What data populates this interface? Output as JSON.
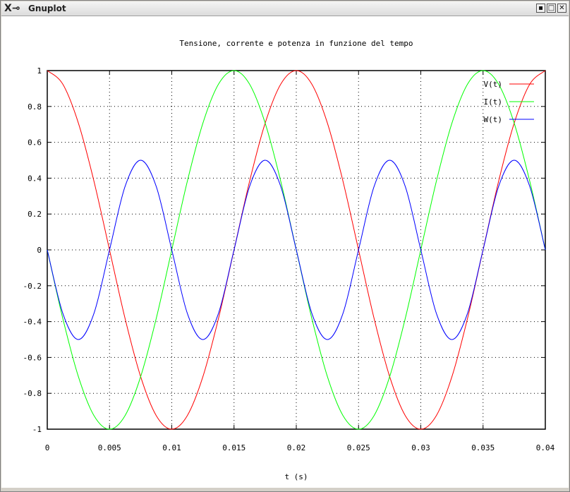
{
  "window": {
    "title": "Gnuplot",
    "icon": "x-window-icon",
    "buttons": [
      "minimize-icon",
      "maximize-icon",
      "close-icon"
    ]
  },
  "chart_data": {
    "type": "line",
    "title": "Tensione, corrente e potenza in funzione del tempo",
    "xlabel": "t (s)",
    "ylabel": "",
    "xlim": [
      0,
      0.04
    ],
    "ylim": [
      -1,
      1
    ],
    "grid": true,
    "legend_position": "top-right",
    "x_ticks": [
      "0",
      "0.005",
      "0.01",
      "0.015",
      "0.02",
      "0.025",
      "0.03",
      "0.035",
      "0.04"
    ],
    "y_ticks": [
      "1",
      "0.8",
      "0.6",
      "0.4",
      "0.2",
      "0",
      "-0.2",
      "-0.4",
      "-0.6",
      "-0.8",
      "-1"
    ],
    "series": [
      {
        "name": "V(t)",
        "color": "#ff0000",
        "x": [
          0,
          0.00125,
          0.0025,
          0.00375,
          0.005,
          0.00625,
          0.0075,
          0.00875,
          0.01,
          0.01125,
          0.0125,
          0.01375,
          0.015,
          0.01625,
          0.0175,
          0.01875,
          0.02,
          0.02125,
          0.0225,
          0.02375,
          0.025,
          0.02625,
          0.0275,
          0.02875,
          0.03,
          0.03125,
          0.0325,
          0.03375,
          0.035,
          0.03625,
          0.0375,
          0.03875,
          0.04
        ],
        "values": [
          1,
          0.924,
          0.707,
          0.383,
          0,
          -0.383,
          -0.707,
          -0.924,
          -1,
          -0.924,
          -0.707,
          -0.383,
          0,
          0.383,
          0.707,
          0.924,
          1,
          0.924,
          0.707,
          0.383,
          0,
          -0.383,
          -0.707,
          -0.924,
          -1,
          -0.924,
          -0.707,
          -0.383,
          0,
          0.383,
          0.707,
          0.924,
          1
        ]
      },
      {
        "name": "I(t)",
        "color": "#00ff00",
        "x": [
          0,
          0.00125,
          0.0025,
          0.00375,
          0.005,
          0.00625,
          0.0075,
          0.00875,
          0.01,
          0.01125,
          0.0125,
          0.01375,
          0.015,
          0.01625,
          0.0175,
          0.01875,
          0.02,
          0.02125,
          0.0225,
          0.02375,
          0.025,
          0.02625,
          0.0275,
          0.02875,
          0.03,
          0.03125,
          0.0325,
          0.03375,
          0.035,
          0.03625,
          0.0375,
          0.03875,
          0.04
        ],
        "values": [
          0,
          -0.383,
          -0.707,
          -0.924,
          -1,
          -0.924,
          -0.707,
          -0.383,
          0,
          0.383,
          0.707,
          0.924,
          1,
          0.924,
          0.707,
          0.383,
          0,
          -0.383,
          -0.707,
          -0.924,
          -1,
          -0.924,
          -0.707,
          -0.383,
          0,
          0.383,
          0.707,
          0.924,
          1,
          0.924,
          0.707,
          0.383,
          0
        ]
      },
      {
        "name": "W(t)",
        "color": "#0000ff",
        "x": [
          0,
          0.00125,
          0.0025,
          0.00375,
          0.005,
          0.00625,
          0.0075,
          0.00875,
          0.01,
          0.01125,
          0.0125,
          0.01375,
          0.015,
          0.01625,
          0.0175,
          0.01875,
          0.02,
          0.02125,
          0.0225,
          0.02375,
          0.025,
          0.02625,
          0.0275,
          0.02875,
          0.03,
          0.03125,
          0.0325,
          0.03375,
          0.035,
          0.03625,
          0.0375,
          0.03875,
          0.04
        ],
        "values": [
          0,
          -0.354,
          -0.5,
          -0.354,
          0,
          0.354,
          0.5,
          0.354,
          0,
          -0.354,
          -0.5,
          -0.354,
          0,
          0.354,
          0.5,
          0.354,
          0,
          -0.354,
          -0.5,
          -0.354,
          0,
          0.354,
          0.5,
          0.354,
          0,
          -0.354,
          -0.5,
          -0.354,
          0,
          0.354,
          0.5,
          0.354,
          0
        ]
      }
    ]
  }
}
